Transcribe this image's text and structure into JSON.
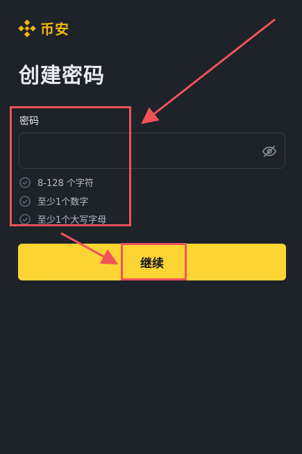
{
  "brand": {
    "name": "币安",
    "color": "#f0b90b",
    "icon": "binance-diamond-icon"
  },
  "page": {
    "title": "创建密码"
  },
  "password": {
    "label": "密码",
    "value": "",
    "placeholder": "",
    "toggle_icon": "eye-off-icon"
  },
  "requirements": [
    {
      "text": "8-128 个字符",
      "icon": "check-circle-icon"
    },
    {
      "text": "至少1个数字",
      "icon": "check-circle-icon"
    },
    {
      "text": "至少1个大写字母",
      "icon": "check-circle-icon"
    }
  ],
  "actions": {
    "continue_label": "继续",
    "color": "#fcd535"
  },
  "annotation": {
    "color": "#f0525b"
  }
}
